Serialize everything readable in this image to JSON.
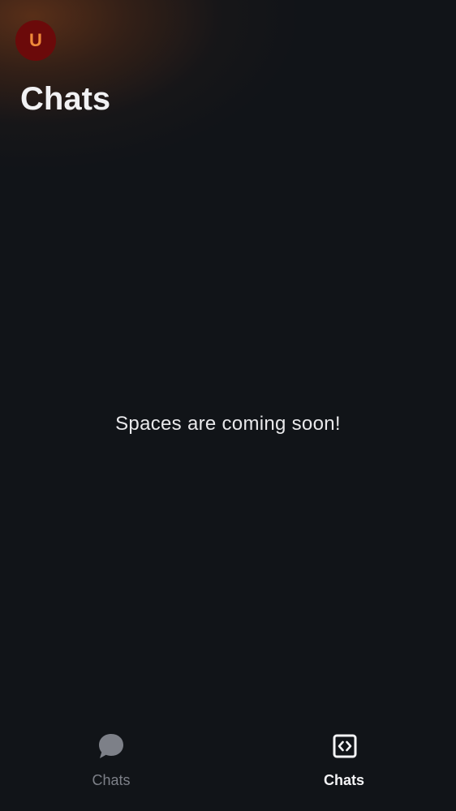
{
  "header": {
    "avatar_letter": "U",
    "title": "Chats"
  },
  "main": {
    "empty_message": "Spaces are coming soon!"
  },
  "bottom_nav": {
    "items": [
      {
        "label": "Chats",
        "icon": "chat-bubble-icon",
        "active": false
      },
      {
        "label": "Chats",
        "icon": "code-brackets-icon",
        "active": true
      }
    ]
  },
  "colors": {
    "background": "#111418",
    "avatar_bg": "#6b0a0a",
    "avatar_letter": "#f08a3a",
    "inactive_nav": "#7d8088",
    "active_nav": "#f4f4f6"
  }
}
